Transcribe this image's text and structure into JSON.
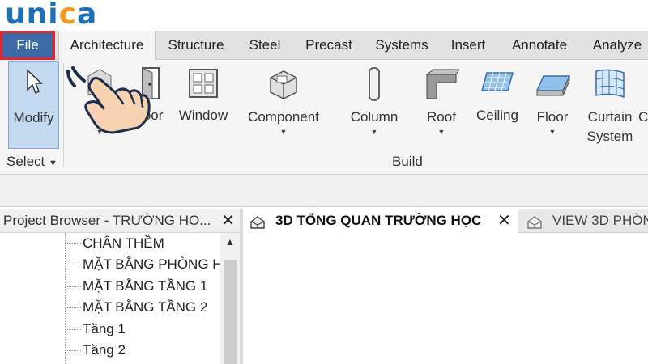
{
  "brand": {
    "logo_text": "unica",
    "accent": "#f39a1e",
    "primary": "#1d6fb8"
  },
  "ribbon_tabs": [
    "File",
    "Architecture",
    "Structure",
    "Steel",
    "Precast",
    "Systems",
    "Insert",
    "Annotate",
    "Analyze"
  ],
  "ribbon_active_tab": "Architecture",
  "tools": {
    "modify": "Modify",
    "wall": "Wa",
    "door": "Door",
    "window": "Window",
    "component": "Component",
    "column": "Column",
    "roof": "Roof",
    "ceiling": "Ceiling",
    "floor": "Floor",
    "curtain_system_line1": "Curtain",
    "curtain_system_line2": "System",
    "curtain_grid_partial": "C"
  },
  "panels": {
    "select": "Select",
    "build": "Build"
  },
  "project_browser": {
    "title": "Project Browser - TRƯỜNG HỌ...",
    "items": [
      "CHÂN THỀM",
      "MẶT BẰNG PHÒNG H",
      "MẶT BẰNG TẦNG 1",
      "MẶT BẰNG TẦNG 2",
      "Tầng 1",
      "Tầng 2"
    ]
  },
  "view_tabs": {
    "active": "3D TỔNG QUAN TRƯỜNG HỌC",
    "second": "VIEW 3D PHÒN"
  },
  "icons": [
    "cursor-icon",
    "door-icon",
    "window-icon",
    "component-icon",
    "column-icon",
    "roof-icon",
    "ceiling-icon",
    "floor-icon",
    "curtain-system-icon",
    "view-3d-icon",
    "close-icon",
    "hand-pointer-icon"
  ],
  "colors": {
    "file_tab": "#3b6aa6",
    "highlight_border": "#e3262b",
    "modify_selected": "#c3daf1"
  }
}
